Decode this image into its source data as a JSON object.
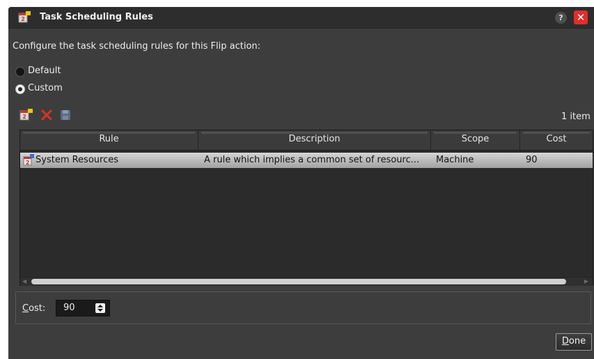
{
  "window": {
    "title": "Task Scheduling Rules",
    "help_label": "?",
    "close_label": "✕"
  },
  "intro": "Configure the task scheduling rules for this Flip action:",
  "options": {
    "default_label": "Default",
    "custom_label": "Custom",
    "selected": "Custom"
  },
  "toolbar": {
    "item_count": "1 item",
    "icons": [
      "new-rule-icon",
      "delete-icon",
      "save-icon"
    ]
  },
  "grid": {
    "columns": [
      "Rule",
      "Description",
      "Scope",
      "Cost"
    ],
    "rows": [
      {
        "rule": "System Resources",
        "description": "A rule which implies a common set of resourc...",
        "scope": "Machine",
        "cost": "90"
      }
    ]
  },
  "cost": {
    "label_first": "C",
    "label_rest": "ost:",
    "value": "90"
  },
  "done": {
    "label_first": "D",
    "label_rest": "one"
  },
  "colors": {
    "background": "#3d3d3d",
    "titlebar": "#2d2d2d",
    "close": "#e22d2d",
    "selected_row": "#c4c4c4"
  }
}
